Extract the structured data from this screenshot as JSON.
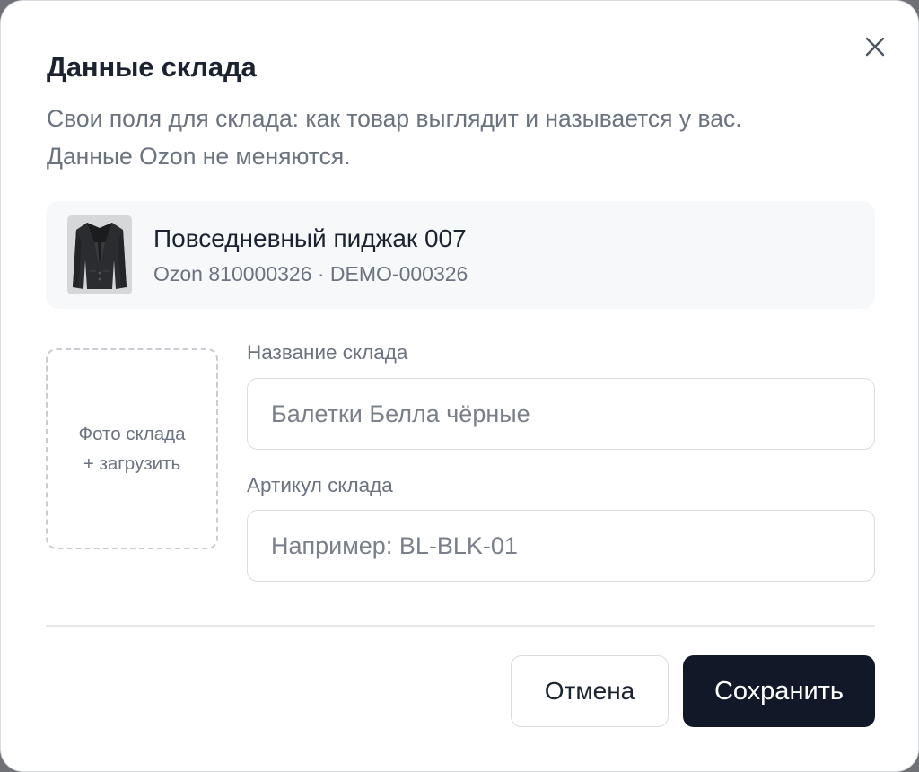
{
  "dialog": {
    "title": "Данные склада",
    "description_line1": "Свои поля для склада: как товар выглядит и называется у вас.",
    "description_line2": "Данные Ozon не меняются."
  },
  "product": {
    "name": "Повседневный пиджак 007",
    "meta": "Ozon 810000326 · DEMO-000326",
    "thumbnail_icon": "jacket-image"
  },
  "photo_upload": {
    "line1": "Фото склада",
    "line2": "+ загрузить"
  },
  "fields": {
    "name_label": "Название склада",
    "name_placeholder": "Балетки Белла чёрные",
    "name_value": "",
    "sku_label": "Артикул склада",
    "sku_placeholder": "Например: BL-BLK-01",
    "sku_value": ""
  },
  "actions": {
    "cancel_label": "Отмена",
    "save_label": "Сохранить"
  },
  "colors": {
    "primary": "#111827",
    "muted_text": "#6b7280",
    "card_bg": "#f7f8fa",
    "border": "#d9dce1"
  }
}
